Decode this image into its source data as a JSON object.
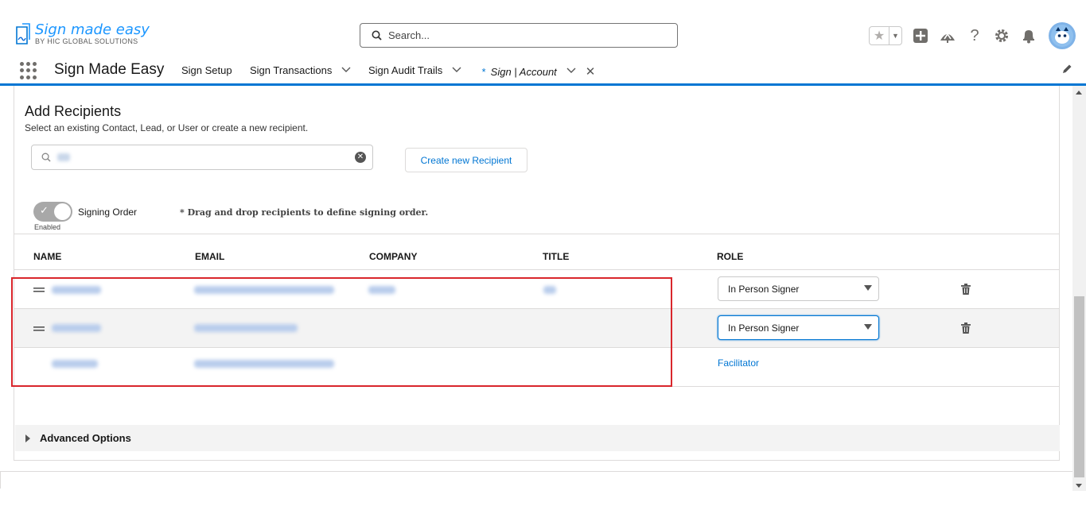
{
  "brand": {
    "logo_main": "Sign made easy",
    "logo_sub": "BY HIC GLOBAL SOLUTIONS"
  },
  "header": {
    "search_placeholder": "Search...",
    "icons": [
      "star-icon",
      "chevron-down-icon",
      "add-icon",
      "trailhead-icon",
      "help-icon",
      "gear-icon",
      "bell-icon",
      "avatar"
    ]
  },
  "nav": {
    "app_name": "Sign Made Easy",
    "items": [
      {
        "label": "Sign Setup"
      },
      {
        "label": "Sign Transactions"
      },
      {
        "label": "Sign Audit Trails"
      },
      {
        "label": "* Sign | Account"
      }
    ]
  },
  "recipients": {
    "title": "Add Recipients",
    "subtitle": "Select an existing Contact, Lead, or User or create a new recipient.",
    "create_button": "Create new Recipient",
    "signing_order_label": "Signing Order",
    "signing_order_status": "Enabled",
    "drag_hint": "* Drag and drop recipients to define signing order.",
    "columns": [
      "NAME",
      "EMAIL",
      "COMPANY",
      "TITLE",
      "ROLE"
    ],
    "rows": [
      {
        "role": "In Person Signer",
        "type": "select"
      },
      {
        "role": "In Person Signer",
        "type": "select"
      },
      {
        "role": "Facilitator",
        "type": "link"
      }
    ],
    "advanced_options": "Advanced Options"
  },
  "colors": {
    "accent": "#0176d3",
    "highlight": "#d9262c"
  }
}
